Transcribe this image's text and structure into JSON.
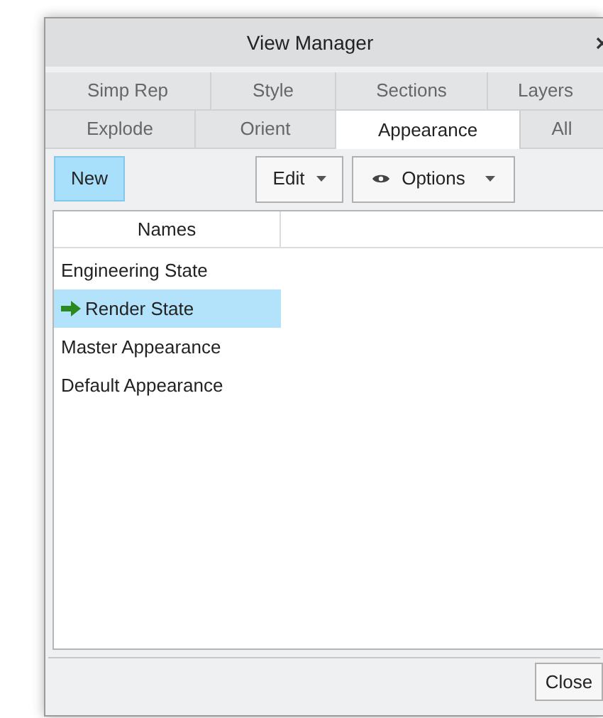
{
  "window": {
    "title": "View Manager"
  },
  "tabs": [
    [
      {
        "label": "Simp Rep",
        "selected": false
      },
      {
        "label": "Style",
        "selected": false
      },
      {
        "label": "Sections",
        "selected": false
      },
      {
        "label": "Layers",
        "selected": false
      }
    ],
    [
      {
        "label": "Explode",
        "selected": false
      },
      {
        "label": "Orient",
        "selected": false
      },
      {
        "label": "Appearance",
        "selected": true
      },
      {
        "label": "All",
        "selected": false
      }
    ]
  ],
  "toolbar": {
    "new": "New",
    "edit": "Edit",
    "options": "Options"
  },
  "list": {
    "columns": [
      "Names"
    ],
    "rows": [
      {
        "name": "Engineering State",
        "selected": false,
        "active": false
      },
      {
        "name": "Render State",
        "selected": true,
        "active": true
      },
      {
        "name": "Master Appearance",
        "selected": false,
        "active": false
      },
      {
        "name": "Default Appearance",
        "selected": false,
        "active": false
      }
    ]
  },
  "footer": {
    "close": "Close"
  }
}
